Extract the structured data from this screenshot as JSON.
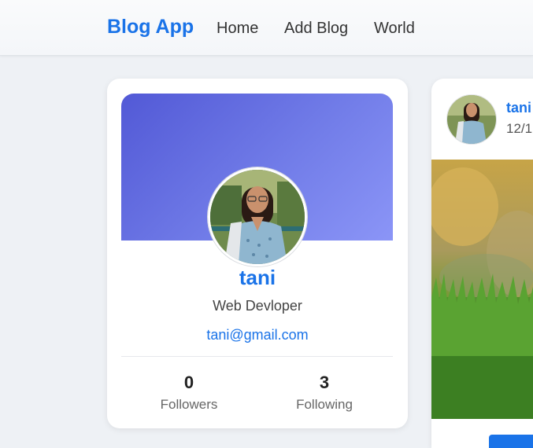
{
  "nav": {
    "brand": "Blog App",
    "links": [
      "Home",
      "Add Blog",
      "World"
    ]
  },
  "profile": {
    "name": "tani",
    "bio": "Web Devloper",
    "email": "tani@gmail.com",
    "stats": [
      {
        "value": "0",
        "label": "Followers"
      },
      {
        "value": "3",
        "label": "Following"
      }
    ]
  },
  "post": {
    "author": "tani",
    "date": "12/1"
  },
  "colors": {
    "accent": "#1a73e8",
    "cover_start": "#5259d6",
    "cover_end": "#8b95f7"
  }
}
